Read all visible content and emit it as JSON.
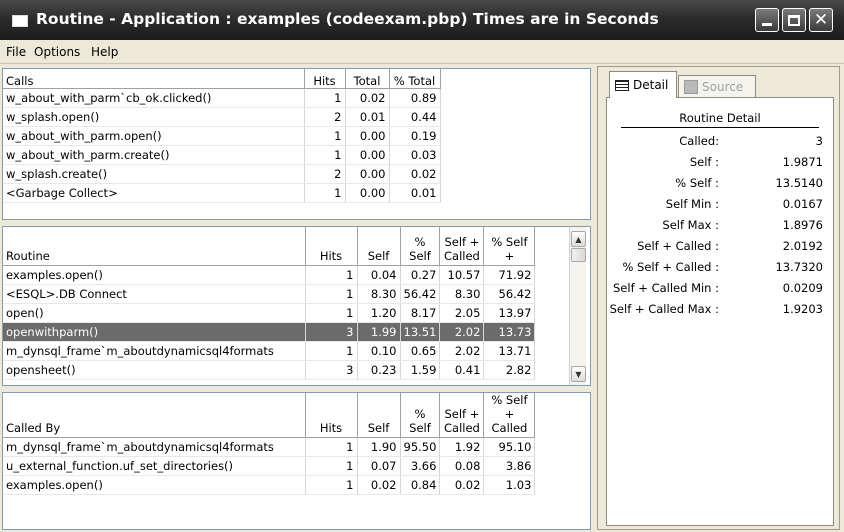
{
  "window": {
    "title": "Routine - Application : examples (codeexam.pbp) Times are in Seconds"
  },
  "menu": [
    "File",
    "Options",
    "Help"
  ],
  "calls": {
    "headers": [
      "Calls",
      "Hits",
      "Total",
      "% Total"
    ],
    "rows": [
      [
        "w_about_with_parm`cb_ok.clicked()",
        "1",
        "0.02",
        "0.89"
      ],
      [
        "w_splash.open()",
        "2",
        "0.01",
        "0.44"
      ],
      [
        "w_about_with_parm.open()",
        "1",
        "0.00",
        "0.19"
      ],
      [
        "w_about_with_parm.create()",
        "1",
        "0.00",
        "0.03"
      ],
      [
        "w_splash.create()",
        "2",
        "0.00",
        "0.02"
      ],
      [
        "<Garbage Collect>",
        "1",
        "0.00",
        "0.01"
      ]
    ]
  },
  "routines": {
    "headers": [
      "Routine",
      "Hits",
      "Self",
      "% Self",
      "Self + Called",
      "% Self +"
    ],
    "rows": [
      [
        "examples.open()",
        "1",
        "0.04",
        "0.27",
        "10.57",
        "71.92"
      ],
      [
        "<ESQL>.DB Connect",
        "1",
        "8.30",
        "56.42",
        "8.30",
        "56.42"
      ],
      [
        "open()",
        "1",
        "1.20",
        "8.17",
        "2.05",
        "13.97"
      ],
      [
        "openwithparm()",
        "3",
        "1.99",
        "13.51",
        "2.02",
        "13.73"
      ],
      [
        "m_dynsql_frame`m_aboutdynamicsql4formats",
        "1",
        "0.10",
        "0.65",
        "2.02",
        "13.71"
      ],
      [
        "opensheet()",
        "3",
        "0.23",
        "1.59",
        "0.41",
        "2.82"
      ]
    ],
    "selected_index": 3
  },
  "called_by": {
    "headers": [
      "Called By",
      "Hits",
      "Self",
      "% Self",
      "Self + Called",
      "% Self + Called"
    ],
    "rows": [
      [
        "m_dynsql_frame`m_aboutdynamicsql4formats",
        "1",
        "1.90",
        "95.50",
        "1.92",
        "95.10"
      ],
      [
        "u_external_function.uf_set_directories()",
        "1",
        "0.07",
        "3.66",
        "0.08",
        "3.86"
      ],
      [
        "examples.open()",
        "1",
        "0.02",
        "0.84",
        "0.02",
        "1.03"
      ]
    ]
  },
  "detail": {
    "tabs": {
      "detail": "Detail",
      "source": "Source"
    },
    "title": "Routine Detail",
    "rows": [
      {
        "label": "Called:",
        "value": "3"
      },
      {
        "label": "Self :",
        "value": "1.9871"
      },
      {
        "label": "% Self :",
        "value": "13.5140"
      },
      {
        "label": "Self Min :",
        "value": "0.0167"
      },
      {
        "label": "Self Max :",
        "value": "1.8976"
      },
      {
        "label": "Self + Called :",
        "value": "2.0192"
      },
      {
        "label": "% Self + Called :",
        "value": "13.7320"
      },
      {
        "label": "Self + Called Min :",
        "value": "0.0209"
      },
      {
        "label": "Self + Called Max :",
        "value": "1.9203"
      }
    ]
  }
}
